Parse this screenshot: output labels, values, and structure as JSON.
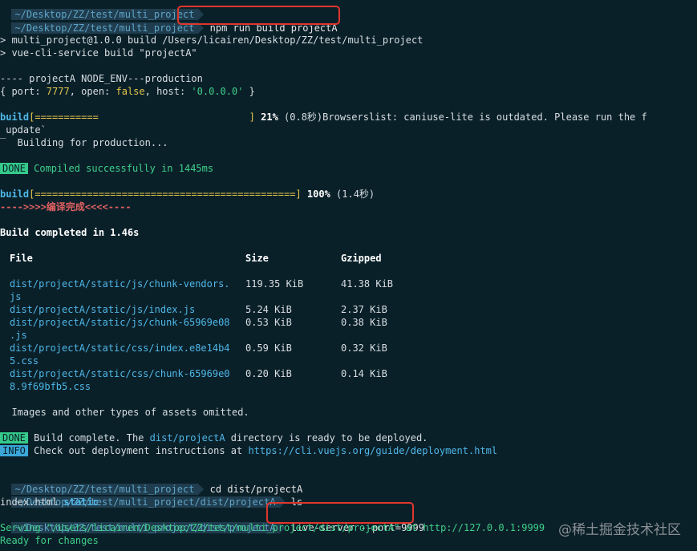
{
  "prompts": {
    "p0": "~/Desktop/ZZ/test/multi_project",
    "p1": "~/Desktop/ZZ/test/multi_project",
    "p2": "~/Desktop/ZZ/test/multi_project",
    "p3": "~/Desktop/ZZ/test/multi_project/dist/projectA",
    "p4": "~/Desktop/ZZ/test/multi_project/dist/projectA"
  },
  "commands": {
    "c1": "npm run build projectA",
    "c2": "cd dist/projectA",
    "c3": "ls",
    "c4": "live-server --port=9999"
  },
  "output": {
    "npm1": "> multi_project@1.0.0 build /Users/licairen/Desktop/ZZ/test/multi_project",
    "npm2": "> vue-cli-service build \"projectA\"",
    "env": "---- projectA NODE_ENV---production",
    "cfg_open": "{ port: ",
    "cfg_port": "7777",
    "cfg_mid": ", open: ",
    "cfg_open_val": "false",
    "cfg_mid2": ", host: ",
    "cfg_host": "'0.0.0.0'",
    "cfg_close": " }",
    "build1_label": "build",
    "build1_bar": "[===========                          ]",
    "build1_pct": " 21%",
    "build1_time": " (0.8秒)",
    "build1_msg": "Browserslist: caniuse-lite is outdated. Please run the f",
    "update": " update`",
    "spinner": "‾",
    "building": "  Building for production...",
    "done_tag": "DONE",
    "compiled": " Compiled successfully in 1445ms",
    "build2_label": "build",
    "build2_bar": "[=============================================]",
    "build2_pct": " 100%",
    "build2_time": " (1.4秒)",
    "finish": "---->>>>编译完成<<<<----",
    "completed": "Build completed in 1.46s",
    "images_omitted": "  Images and other types of assets omitted.",
    "done_tag2": "DONE",
    "build_complete_pre": " Build complete. The ",
    "build_complete_dir": "dist/projectA",
    "build_complete_post": " directory is ready to be deployed.",
    "info_tag": "INFO",
    "info_pre": " Check out deployment instructions at ",
    "info_url": "https://cli.vuejs.org/guide/deployment.html",
    "ls_index": "index.html ",
    "ls_static": "static",
    "serving": "Serving \"/Users/licairen/Desktop/ZZ/test/multi_project/dist/projectA\" at http://127.0.0.1:9999",
    "ready": "Ready for changes"
  },
  "table": {
    "headers": [
      "File",
      "Size",
      "Gzipped"
    ],
    "rows": [
      {
        "file1": "dist/projectA/static/js/chunk-vendors.",
        "file2": "js",
        "size": "119.35 KiB",
        "gz": "41.38 KiB"
      },
      {
        "file1": "dist/projectA/static/js/index.js",
        "file2": "",
        "size": "5.24 KiB",
        "gz": "2.37 KiB"
      },
      {
        "file1": "dist/projectA/static/js/chunk-65969e08",
        "file2": ".js",
        "size": "0.53 KiB",
        "gz": "0.38 KiB"
      },
      {
        "file1": "dist/projectA/static/css/index.e8e14b4",
        "file2": "5.css",
        "size": "0.59 KiB",
        "gz": "0.32 KiB"
      },
      {
        "file1": "dist/projectA/static/css/chunk-65969e0",
        "file2": "8.9f69bfb5.css",
        "size": "0.20 KiB",
        "gz": "0.14 KiB"
      }
    ]
  },
  "watermark": "@稀土掘金技术社区",
  "colors": {
    "background": "#0a2029",
    "highlight": "#e0362c",
    "done": "#35c98a",
    "info": "#3aa7d8"
  }
}
